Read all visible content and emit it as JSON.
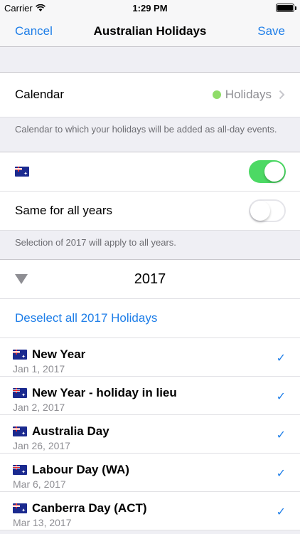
{
  "status_bar": {
    "carrier": "Carrier",
    "time": "1:29 PM",
    "wifi_icon": "wifi-icon",
    "battery_icon": "battery-icon"
  },
  "nav": {
    "cancel": "Cancel",
    "title": "Australian Holidays",
    "save": "Save"
  },
  "calendar": {
    "label": "Calendar",
    "value": "Holidays",
    "dot_color": "#8fdc68",
    "footer": "Calendar to which your holidays will be added as all-day events."
  },
  "country_toggle": {
    "flag_icon": "australia-flag-icon",
    "on": true
  },
  "same_all_years": {
    "label": "Same for all years",
    "on": false,
    "footer": "Selection of 2017 will apply to all years."
  },
  "year": {
    "label": "2017",
    "deselect": "Deselect all 2017 Holidays"
  },
  "holidays": [
    {
      "name": "New Year",
      "date": "Jan 1, 2017",
      "checked": "✓"
    },
    {
      "name": "New Year - holiday in lieu",
      "date": "Jan 2, 2017",
      "checked": "✓"
    },
    {
      "name": "Australia Day",
      "date": "Jan 26, 2017",
      "checked": "✓"
    },
    {
      "name": "Labour Day (WA)",
      "date": "Mar 6, 2017",
      "checked": "✓"
    },
    {
      "name": "Canberra Day (ACT)",
      "date": "Mar 13, 2017",
      "checked": "✓"
    }
  ],
  "colors": {
    "accent": "#1e7ee8",
    "toggle_on": "#4cd964",
    "background": "#efeff4"
  }
}
